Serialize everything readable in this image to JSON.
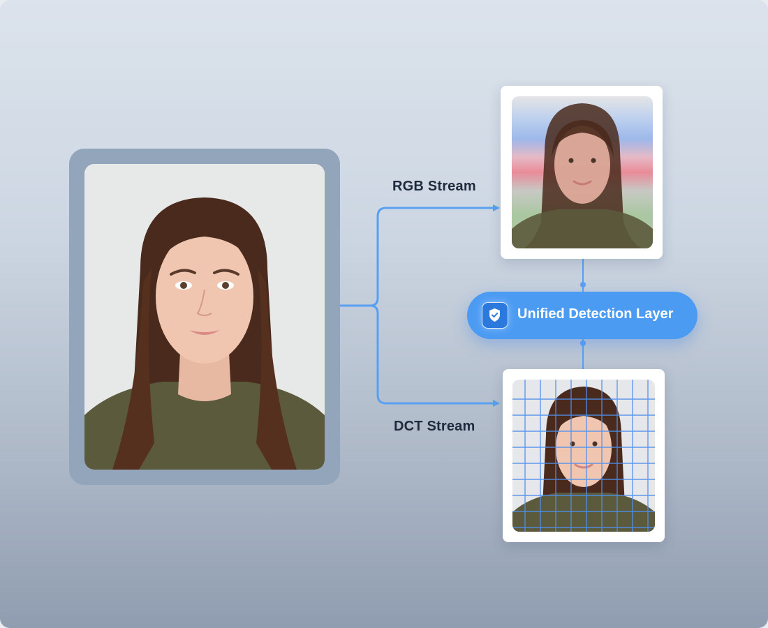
{
  "streams": {
    "rgb_label": "RGB Stream",
    "dct_label": "DCT Stream"
  },
  "detection": {
    "label": "Unified Detection Layer",
    "icon": "shield-check-icon"
  },
  "colors": {
    "accent": "#4c9bf3",
    "connector": "#5aa0f2",
    "frame": "#92a5bb",
    "label_text": "#1f2a3d"
  }
}
